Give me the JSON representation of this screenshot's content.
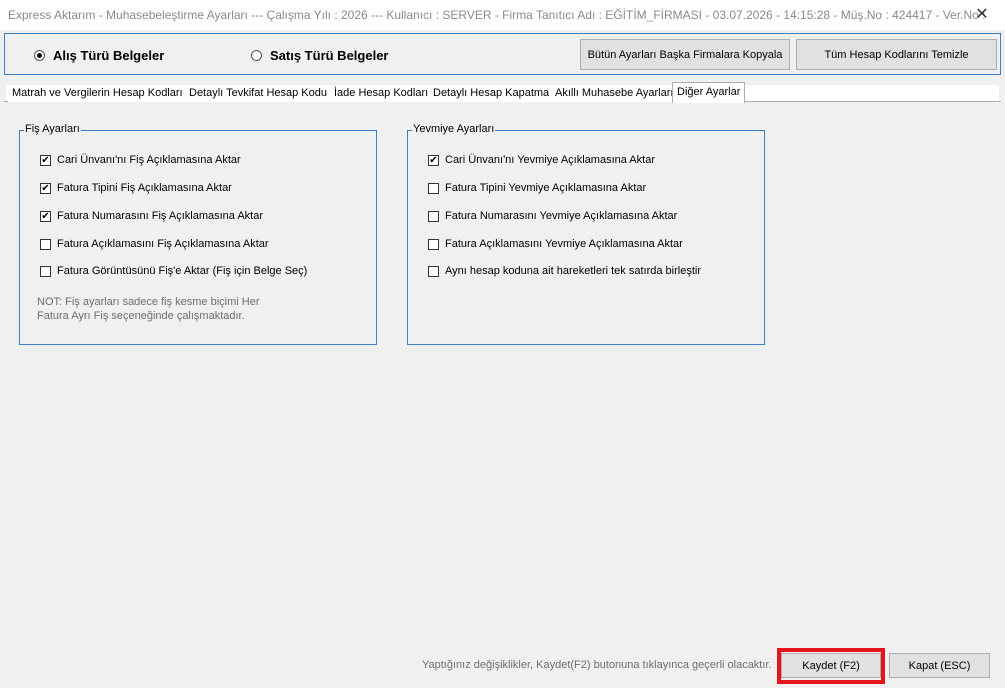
{
  "window": {
    "title": "Express Aktarım - Muhasebeleştirme Ayarları  ---  Çalışma Yılı : 2026  ---  Kullanıcı : SERVER - Firma Tanıtıcı Adı : EĞİTİM_FİRMASI - 03.07.2026 - 14:15:28 - Müş.No : 424417 - Ver.No :",
    "close_glyph": "✕"
  },
  "doc_type": {
    "options": [
      "Alış Türü Belgeler",
      "Satış Türü Belgeler"
    ],
    "selected": "Alış Türü Belgeler"
  },
  "actions": {
    "copy_all": "Bütün Ayarları Başka Firmalara Kopyala",
    "clear_all": "Tüm Hesap Kodlarını Temizle"
  },
  "tabs": [
    "Matrah ve Vergilerin Hesap Kodları",
    "Detaylı Tevkifat Hesap Kodu",
    "İade Hesap Kodları",
    "Detaylı Hesap Kapatma",
    "Akıllı Muhasebe Ayarları",
    "Diğer Ayarlar"
  ],
  "active_tab": "Diğer Ayarlar",
  "fis_group": {
    "title": "Fiş Ayarları",
    "items": [
      {
        "label": "Cari Ünvanı'nı Fiş Açıklamasına Aktar",
        "checked": true
      },
      {
        "label": "Fatura Tipini Fiş Açıklamasına Aktar",
        "checked": true
      },
      {
        "label": "Fatura Numarasını Fiş Açıklamasına Aktar",
        "checked": true
      },
      {
        "label": "Fatura Açıklamasını Fiş Açıklamasına Aktar",
        "checked": false
      },
      {
        "label": "Fatura Görüntüsünü Fiş'e Aktar (Fiş için Belge Seç)",
        "checked": false
      }
    ],
    "note_line1": "NOT: Fiş ayarları sadece fiş kesme biçimi Her",
    "note_line2": "Fatura Ayrı Fiş seçeneğinde çalışmaktadır."
  },
  "yevmiye_group": {
    "title": "Yevmiye Ayarları",
    "items": [
      {
        "label": "Cari Ünvanı'nı Yevmiye Açıklamasına Aktar",
        "checked": true
      },
      {
        "label": "Fatura Tipini Yevmiye Açıklamasına Aktar",
        "checked": false
      },
      {
        "label": "Fatura Numarasını Yevmiye Açıklamasına Aktar",
        "checked": false
      },
      {
        "label": "Fatura Açıklamasını Yevmiye Açıklamasına Aktar",
        "checked": false
      },
      {
        "label": "Aynı hesap koduna ait hareketleri tek satırda birleştir",
        "checked": false
      }
    ]
  },
  "footer": {
    "hint": "Yaptığınız değişiklikler, Kaydet(F2) butonuna tıklayınca geçerli olacaktır.",
    "save": "Kaydet (F2)",
    "close": "Kapat (ESC)"
  },
  "colors": {
    "group_border": "#3c7fc4",
    "highlight": "#e8141b"
  }
}
